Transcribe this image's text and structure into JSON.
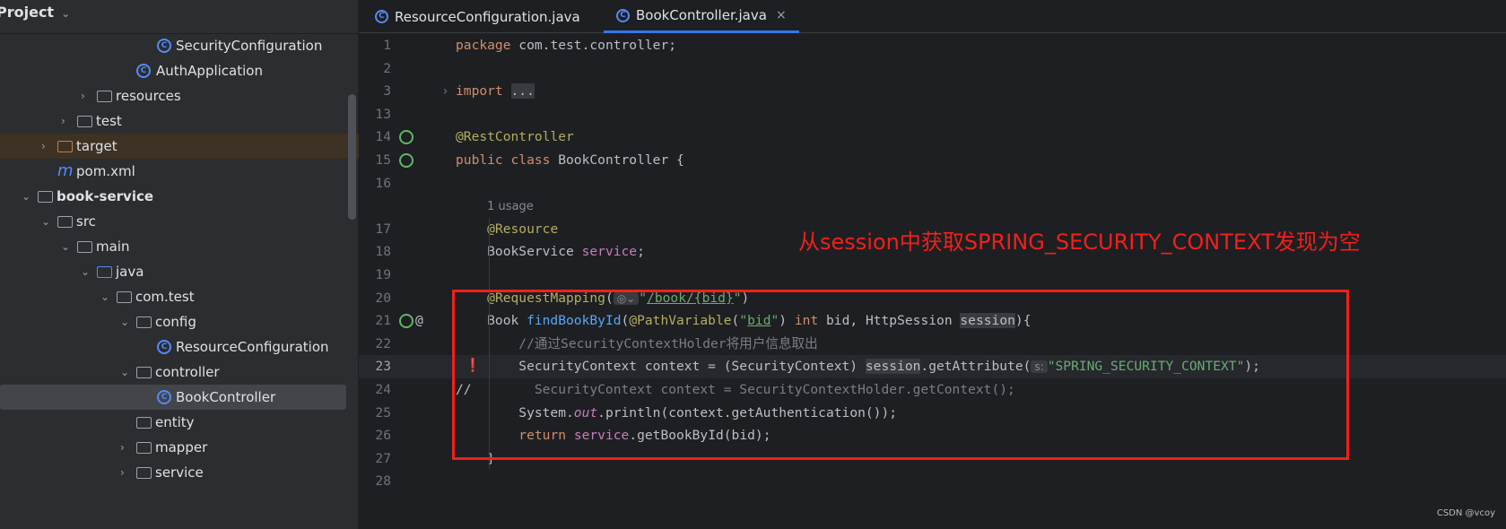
{
  "sidebar": {
    "title": "Project",
    "items": [
      {
        "label": "SecurityConfiguration",
        "icon": "class-icon"
      },
      {
        "label": "AuthApplication",
        "icon": "spring-app-icon"
      },
      {
        "label": "resources",
        "icon": "resources-folder-icon"
      },
      {
        "label": "test",
        "icon": "folder-icon"
      },
      {
        "label": "target",
        "icon": "excluded-folder-icon"
      },
      {
        "label": "pom.xml",
        "icon": "maven-icon"
      },
      {
        "label": "book-service",
        "icon": "module-folder-icon"
      },
      {
        "label": "src",
        "icon": "folder-icon"
      },
      {
        "label": "main",
        "icon": "folder-icon"
      },
      {
        "label": "java",
        "icon": "source-folder-icon"
      },
      {
        "label": "com.test",
        "icon": "package-icon"
      },
      {
        "label": "config",
        "icon": "package-icon"
      },
      {
        "label": "ResourceConfiguration",
        "icon": "class-icon"
      },
      {
        "label": "controller",
        "icon": "package-icon"
      },
      {
        "label": "BookController",
        "icon": "class-icon"
      },
      {
        "label": "entity",
        "icon": "package-icon"
      },
      {
        "label": "mapper",
        "icon": "package-icon"
      },
      {
        "label": "service",
        "icon": "package-icon"
      }
    ]
  },
  "tabs": [
    {
      "label": "ResourceConfiguration.java"
    },
    {
      "label": "BookController.java",
      "close": "×"
    }
  ],
  "editor": {
    "numbers": [
      "1",
      "2",
      "3",
      "13",
      "14",
      "15",
      "16",
      "",
      "17",
      "18",
      "19",
      "20",
      "21",
      "22",
      "23",
      "24",
      "25",
      "26",
      "27",
      "28"
    ],
    "usage": "1 usage",
    "hint": "s:",
    "comment_prefix": "//"
  },
  "annotation": "从session中获取SPRING_SECURITY_CONTEXT发现为空",
  "watermark": "CSDN @vcoy",
  "colors": {
    "highlight_box": "#f0201c",
    "accent": "#3574f0"
  }
}
